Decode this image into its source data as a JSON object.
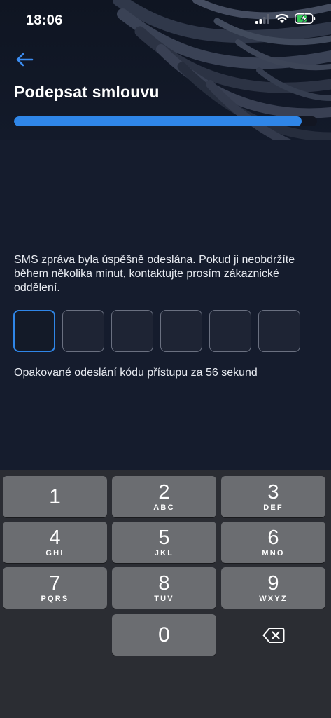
{
  "status_bar": {
    "time": "18:06",
    "icons": [
      "cellular-signal-icon",
      "wifi-icon",
      "battery-charging-icon"
    ]
  },
  "header": {
    "back_icon": "arrow-left-icon",
    "title": "Podepsat smlouvu",
    "progress_fraction": 0.95
  },
  "verification": {
    "message": "SMS zpráva byla úspěšně odeslána. Pokud ji neobdržíte během několika minut, kontaktujte prosím zákaznické oddělení.",
    "code_length": 6,
    "code_values": [
      "",
      "",
      "",
      "",
      "",
      ""
    ],
    "resend_text": "Opakované odeslání kódu přístupu za 56 sekund"
  },
  "keypad": {
    "keys": [
      {
        "digit": "1",
        "letters": ""
      },
      {
        "digit": "2",
        "letters": "ABC"
      },
      {
        "digit": "3",
        "letters": "DEF"
      },
      {
        "digit": "4",
        "letters": "GHI"
      },
      {
        "digit": "5",
        "letters": "JKL"
      },
      {
        "digit": "6",
        "letters": "MNO"
      },
      {
        "digit": "7",
        "letters": "PQRS"
      },
      {
        "digit": "8",
        "letters": "TUV"
      },
      {
        "digit": "9",
        "letters": "WXYZ"
      },
      {
        "digit": "0",
        "letters": ""
      }
    ],
    "backspace_icon": "backspace-icon"
  },
  "colors": {
    "accent": "#2f86e8",
    "background": "#151c2d",
    "keyboard": "#2b2d33",
    "key": "#6b6d71"
  }
}
